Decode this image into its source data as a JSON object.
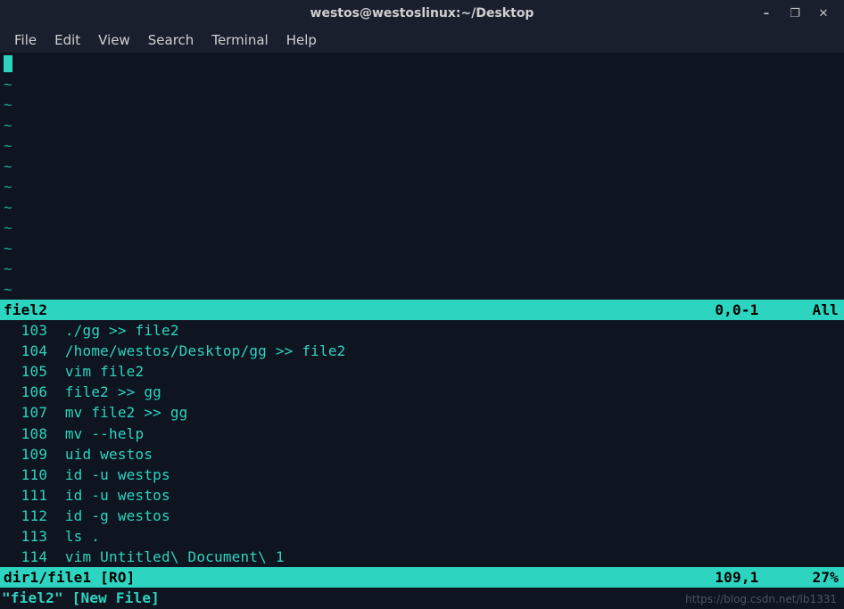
{
  "window": {
    "title": "westos@westoslinux:~/Desktop",
    "controls": {
      "minimize": "–",
      "maximize": "❐",
      "close": "✕"
    }
  },
  "menubar": {
    "file": "File",
    "edit": "Edit",
    "view": "View",
    "search": "Search",
    "terminal": "Terminal",
    "help": "Help"
  },
  "top_pane": {
    "tilde": "~",
    "tilde_count": 11,
    "status": {
      "filename": "fiel2",
      "position": "0,0-1",
      "percent": "All"
    }
  },
  "history": [
    {
      "num": "103",
      "cmd": "./gg >> file2"
    },
    {
      "num": "104",
      "cmd": "/home/westos/Desktop/gg >> file2"
    },
    {
      "num": "105",
      "cmd": "vim file2"
    },
    {
      "num": "106",
      "cmd": "file2 >> gg"
    },
    {
      "num": "107",
      "cmd": "mv file2 >> gg"
    },
    {
      "num": "108",
      "cmd": "mv --help"
    },
    {
      "num": "109",
      "cmd": "uid westos"
    },
    {
      "num": "110",
      "cmd": "id -u westps"
    },
    {
      "num": "111",
      "cmd": "id -u westos"
    },
    {
      "num": "112",
      "cmd": "id -g westos"
    },
    {
      "num": "113",
      "cmd": "ls ."
    },
    {
      "num": "114",
      "cmd": "vim Untitled\\ Document\\ 1"
    }
  ],
  "bottom_pane": {
    "status": {
      "filename": "dir1/file1 [RO]",
      "position": "109,1",
      "percent": "27%"
    }
  },
  "cmdline": "\"fiel2\" [New File]",
  "watermark": "https://blog.csdn.net/lb1331"
}
